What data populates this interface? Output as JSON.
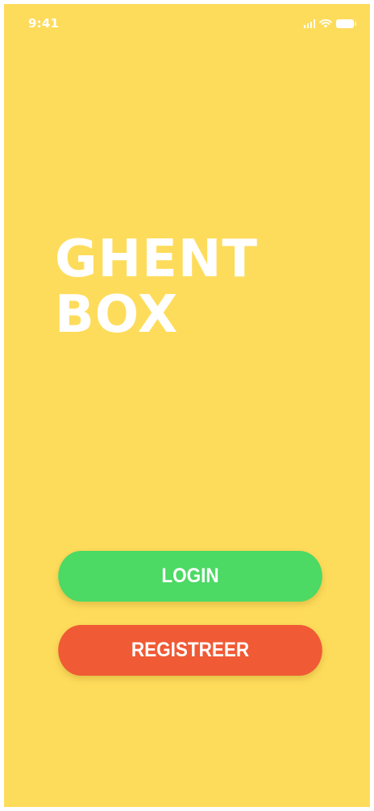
{
  "colors": {
    "background": "#FEDC5B",
    "login_button": "#4CD964",
    "register_button": "#F05A35",
    "text": "#FFFFFF"
  },
  "status_bar": {
    "time": "9:41",
    "icons": [
      "signal-icon",
      "wifi-icon",
      "battery-icon"
    ]
  },
  "brand": {
    "line1": "GHENT",
    "line2": "BOX"
  },
  "actions": {
    "login_label": "LOGIN",
    "register_label": "REGISTREER"
  }
}
